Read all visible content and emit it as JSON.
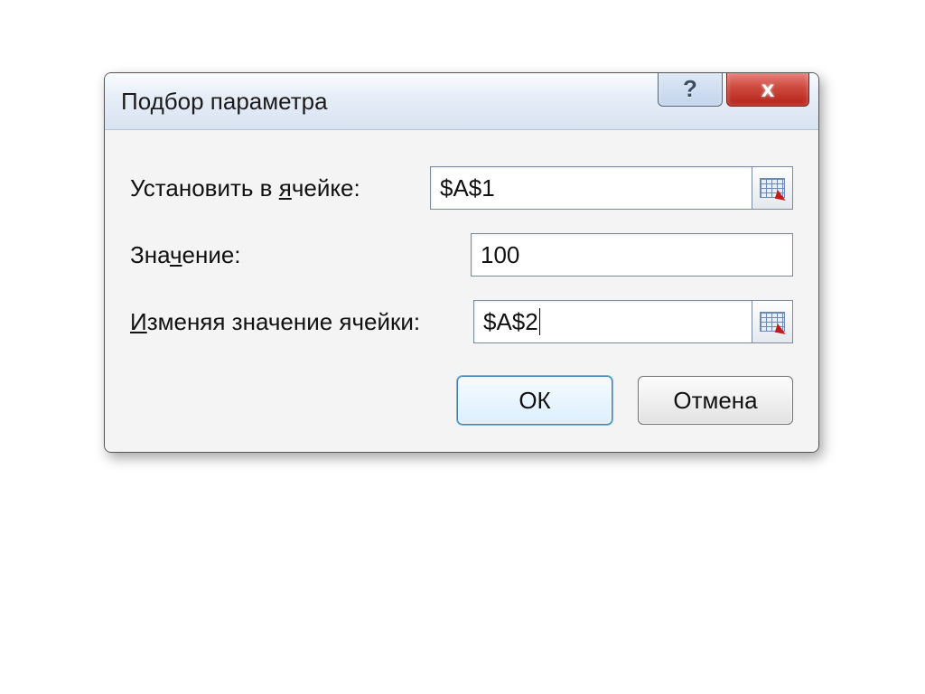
{
  "dialog": {
    "title": "Подбор параметра",
    "help_symbol": "?",
    "close_symbol": "x"
  },
  "fields": {
    "set_cell": {
      "label_pre": "Установить в ",
      "label_ul": "я",
      "label_post": "чейке:",
      "value": "$A$1"
    },
    "target_value": {
      "label_pre": "Зна",
      "label_ul": "ч",
      "label_post": "ение:",
      "value": "100"
    },
    "changing_cell": {
      "label_ul": "И",
      "label_post": "зменяя значение ячейки:",
      "value": "$A$2"
    }
  },
  "buttons": {
    "ok": "ОК",
    "cancel": "Отмена"
  }
}
